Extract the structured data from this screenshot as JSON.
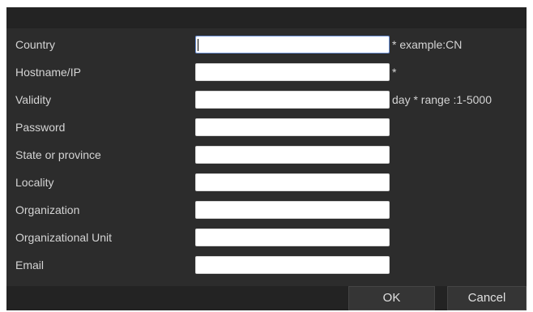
{
  "form": {
    "fields": [
      {
        "label": "Country",
        "value": "",
        "hint": "* example:CN"
      },
      {
        "label": "Hostname/IP",
        "value": "",
        "hint": "*"
      },
      {
        "label": "Validity",
        "value": "",
        "hint": "day *  range :1-5000"
      },
      {
        "label": "Password",
        "value": "",
        "hint": ""
      },
      {
        "label": "State or province",
        "value": "",
        "hint": ""
      },
      {
        "label": "Locality",
        "value": "",
        "hint": ""
      },
      {
        "label": "Organization",
        "value": "",
        "hint": ""
      },
      {
        "label": "Organizational Unit",
        "value": "",
        "hint": ""
      },
      {
        "label": "Email",
        "value": "",
        "hint": ""
      }
    ]
  },
  "footer": {
    "ok_label": "OK",
    "cancel_label": "Cancel"
  }
}
